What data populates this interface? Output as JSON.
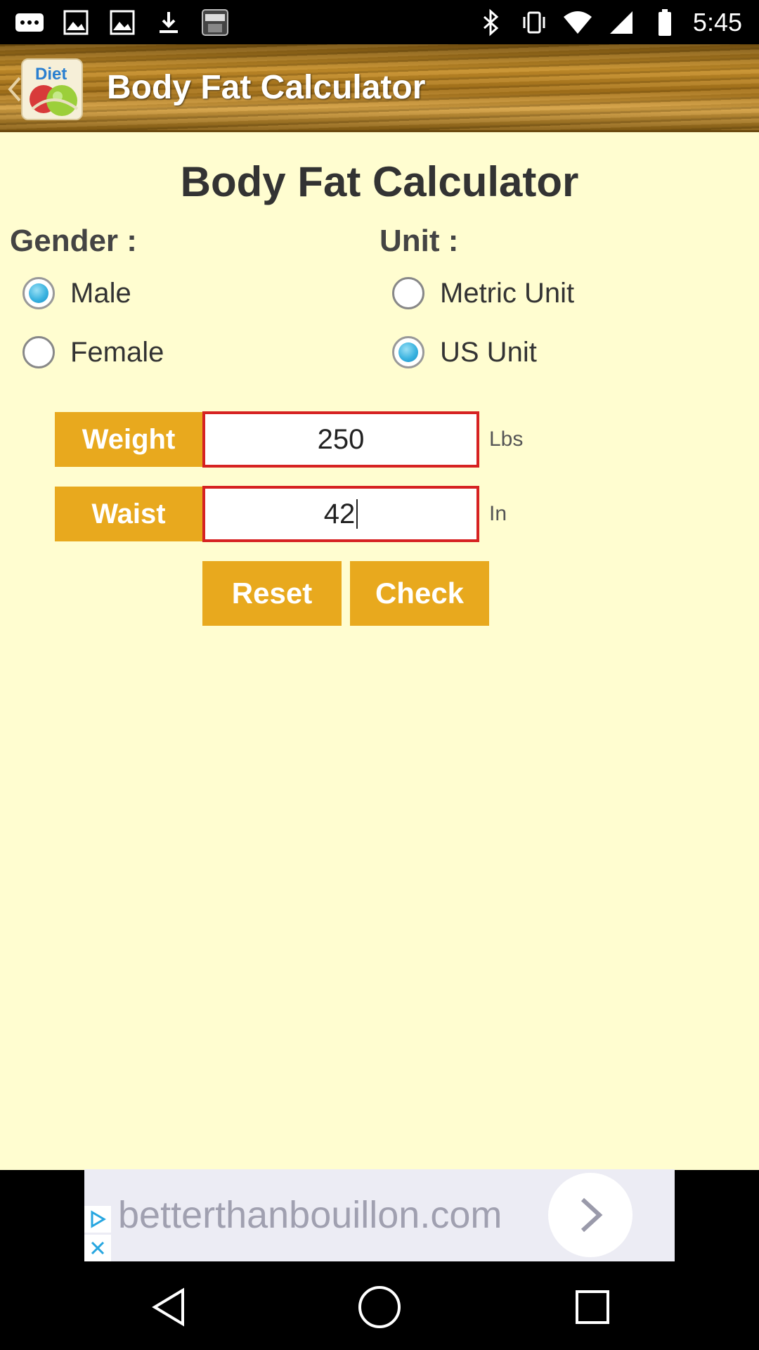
{
  "status_bar": {
    "time": "5:45",
    "left_icons": [
      "more-icon",
      "image-icon",
      "image-icon",
      "download-icon",
      "police-badge-icon"
    ],
    "right_icons": [
      "bluetooth-icon",
      "vibrate-icon",
      "wifi-icon",
      "signal-icon",
      "battery-icon"
    ]
  },
  "action_bar": {
    "title": "Body Fat Calculator",
    "logo_text": "Diet"
  },
  "main": {
    "page_title": "Body Fat Calculator",
    "gender": {
      "label": "Gender :",
      "options": [
        {
          "label": "Male",
          "checked": true
        },
        {
          "label": "Female",
          "checked": false
        }
      ]
    },
    "unit": {
      "label": "Unit :",
      "options": [
        {
          "label": "Metric Unit",
          "checked": false
        },
        {
          "label": "US Unit",
          "checked": true
        }
      ]
    },
    "weight": {
      "label": "Weight",
      "value": "250",
      "unit": "Lbs"
    },
    "waist": {
      "label": "Waist",
      "value": "42",
      "unit": "In"
    },
    "reset_label": "Reset",
    "check_label": "Check"
  },
  "ad": {
    "text": "betterthanbouillon.com"
  },
  "colors": {
    "background": "#fffdd0",
    "accent": "#e8a91e",
    "input_border": "#d62222",
    "radio_checked": "#3bb3e0"
  }
}
